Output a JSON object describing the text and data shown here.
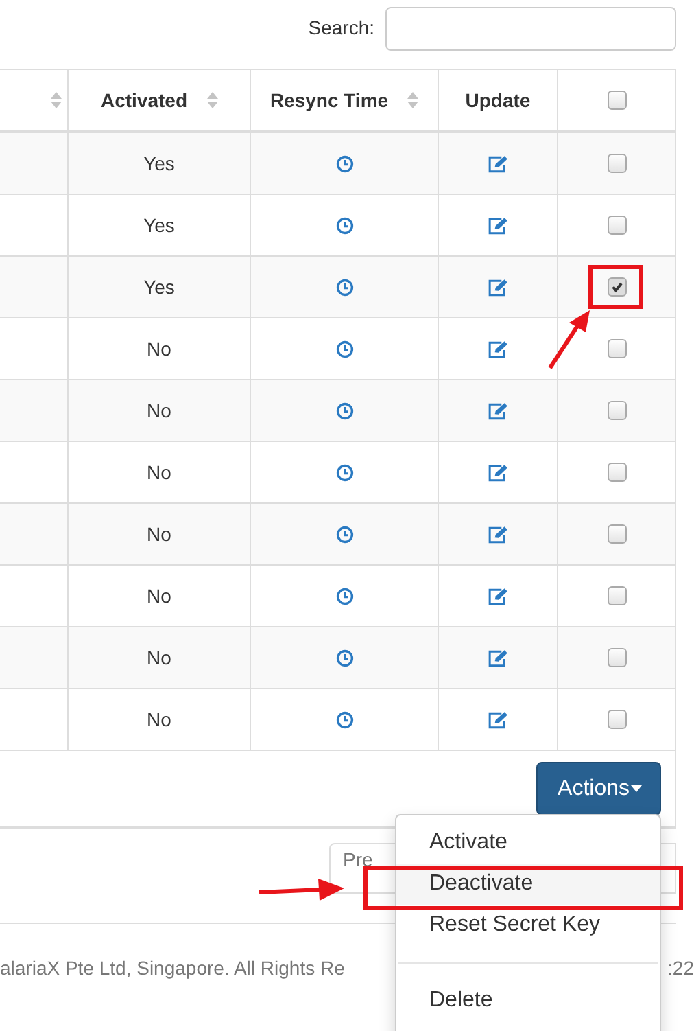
{
  "search": {
    "label": "Search:"
  },
  "table": {
    "columns": [
      {
        "kind": "sort",
        "sortable": true
      },
      {
        "kind": "sort",
        "label": "Activated",
        "sortable": true
      },
      {
        "kind": "sort",
        "label": "Resync Time",
        "sortable": true
      },
      {
        "kind": "sort",
        "label": "Update",
        "sortable": false
      },
      {
        "kind": "checkbox",
        "checked": false
      }
    ],
    "rows": [
      {
        "activated": "Yes",
        "checked": false,
        "highlighted": false
      },
      {
        "activated": "Yes",
        "checked": false,
        "highlighted": false
      },
      {
        "activated": "Yes",
        "checked": true,
        "highlighted": true
      },
      {
        "activated": "No",
        "checked": false,
        "highlighted": false
      },
      {
        "activated": "No",
        "checked": false,
        "highlighted": false
      },
      {
        "activated": "No",
        "checked": false,
        "highlighted": false
      },
      {
        "activated": "No",
        "checked": false,
        "highlighted": false
      },
      {
        "activated": "No",
        "checked": false,
        "highlighted": false
      },
      {
        "activated": "No",
        "checked": false,
        "highlighted": false
      },
      {
        "activated": "No",
        "checked": false,
        "highlighted": false
      }
    ]
  },
  "actions_button": {
    "label": "Actions",
    "expanded": true
  },
  "menu": [
    {
      "kind": "item",
      "label": "Activate",
      "selected": false,
      "highlighted": false
    },
    {
      "kind": "item",
      "label": "Deactivate",
      "selected": true,
      "highlighted": true
    },
    {
      "kind": "item",
      "label": "Reset Secret Key",
      "selected": false,
      "highlighted": false
    },
    {
      "kind": "divider"
    },
    {
      "kind": "item",
      "label": "Delete",
      "selected": false,
      "highlighted": false
    }
  ],
  "pagination": {
    "previous": "Pre"
  },
  "footer": {
    "text": "alariaX Pte Ltd, Singapore. All Rights Re",
    "time": ":22"
  }
}
